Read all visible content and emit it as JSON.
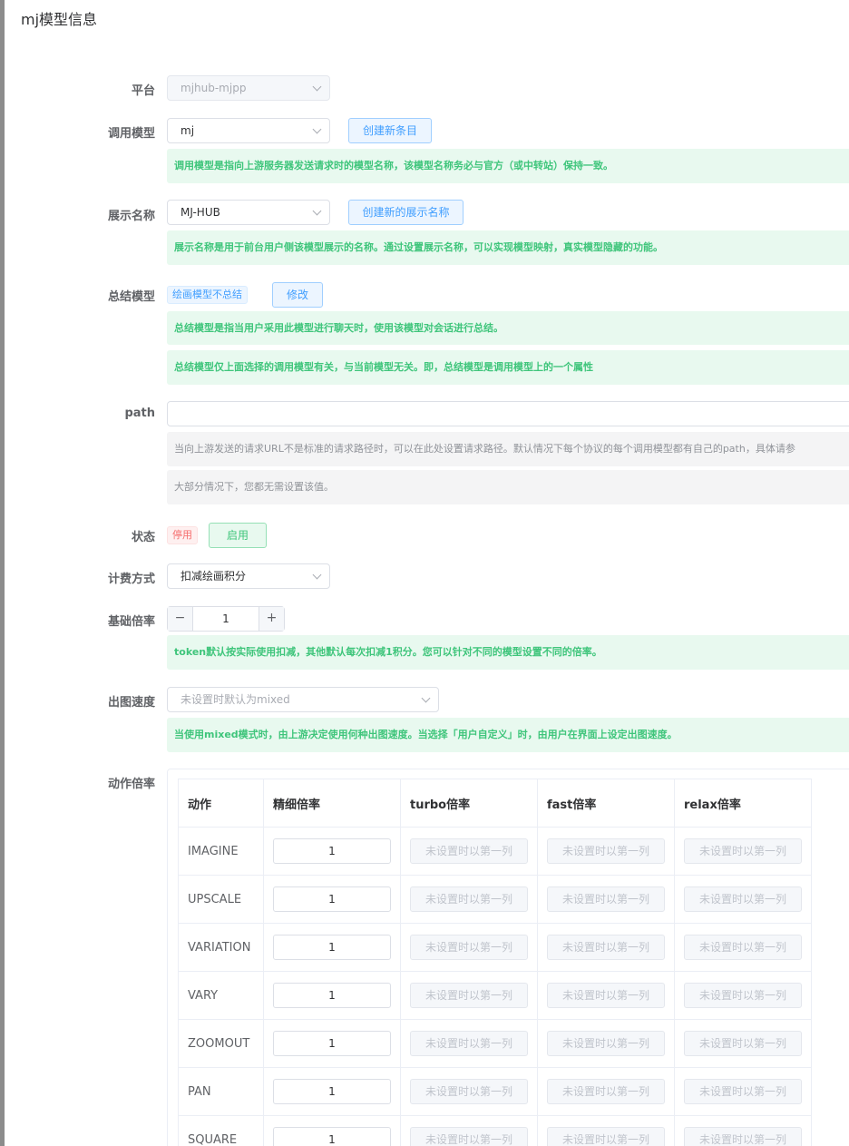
{
  "page": {
    "title": "mj模型信息"
  },
  "form": {
    "platform": {
      "label": "平台",
      "value": "mjhub-mjpp"
    },
    "model": {
      "label": "调用模型",
      "value": "mj",
      "create_button": "创建新条目",
      "hint": "调用模型是指向上游服务器发送请求时的模型名称，该模型名称务必与官方（或中转站）保持一致。"
    },
    "display_name": {
      "label": "展示名称",
      "value": "MJ-HUB",
      "create_button": "创建新的展示名称",
      "hint": "展示名称是用于前台用户侧该模型展示的名称。通过设置展示名称，可以实现模型映射，真实模型隐藏的功能。"
    },
    "summary_model": {
      "label": "总结模型",
      "tag": "绘画模型不总结",
      "edit_button": "修改",
      "hint1": "总结模型是指当用户采用此模型进行聊天时，使用该模型对会话进行总结。",
      "hint2": "总结模型仅上面选择的调用模型有关，与当前模型无关。即，总结模型是调用模型上的一个属性"
    },
    "path": {
      "label": "path",
      "value": "",
      "hint1": "当向上游发送的请求URL不是标准的请求路径时，可以在此处设置请求路径。默认情况下每个协议的每个调用模型都有自己的path，具体请参",
      "hint2": "大部分情况下，您都无需设置该值。"
    },
    "status": {
      "label": "状态",
      "disabled_tag": "停用",
      "enable_button": "启用"
    },
    "billing": {
      "label": "计费方式",
      "value": "扣减绘画积分"
    },
    "base_rate": {
      "label": "基础倍率",
      "minus": "−",
      "value": "1",
      "plus": "+",
      "hint": "token默认按实际使用扣减，其他默认每次扣减1积分。您可以针对不同的模型设置不同的倍率。"
    },
    "speed": {
      "label": "出图速度",
      "placeholder": "未设置时默认为mixed",
      "hint": "当使用mixed模式时，由上游决定使用何种出图速度。当选择「用户自定义」时，由用户在界面上设定出图速度。"
    },
    "action_rate": {
      "label": "动作倍率"
    }
  },
  "table": {
    "headers": [
      "动作",
      "精细倍率",
      "turbo倍率",
      "fast倍率",
      "relax倍率"
    ],
    "placeholder": "未设置时以第一列",
    "rows": [
      {
        "action": "IMAGINE",
        "fine": "1"
      },
      {
        "action": "UPSCALE",
        "fine": "1"
      },
      {
        "action": "VARIATION",
        "fine": "1"
      },
      {
        "action": "VARY",
        "fine": "1"
      },
      {
        "action": "ZOOMOUT",
        "fine": "1"
      },
      {
        "action": "PAN",
        "fine": "1"
      },
      {
        "action": "SQUARE",
        "fine": "1"
      }
    ]
  }
}
